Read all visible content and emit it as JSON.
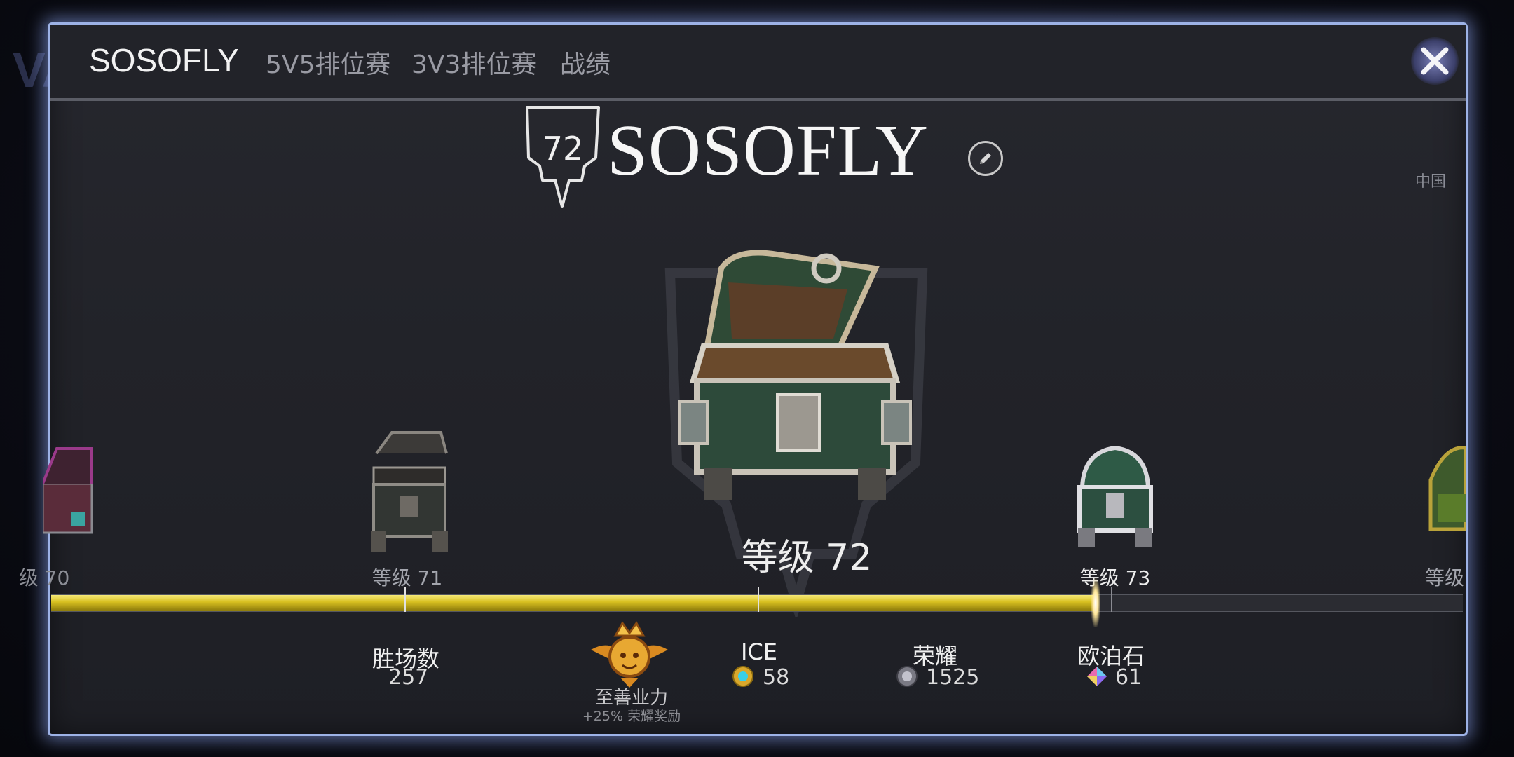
{
  "nav": {
    "title": "SOSOFLY",
    "tabs": [
      "5V5排位赛",
      "3V3排位赛",
      "战绩"
    ],
    "close_icon": "close-icon"
  },
  "region": "中国",
  "profile": {
    "rank_number": "72",
    "name": "SOSOFLY",
    "edit_icon": "pencil-icon"
  },
  "levels": {
    "prev2_label": "级 70",
    "prev_label": "等级 71",
    "current_label": "等级 72",
    "next_label": "等级 73",
    "next2_label": "等级"
  },
  "progress": {
    "percent": 74
  },
  "stats": {
    "wins_label": "胜场数",
    "wins_value": "257",
    "karma_title": "至善业力",
    "karma_bonus": "+25% 荣耀奖励",
    "ice_label": "ICE",
    "ice_value": "58",
    "glory_label": "荣耀",
    "glory_value": "1525",
    "opal_label": "欧泊石",
    "opal_value": "61"
  },
  "colors": {
    "accent_gold": "#d8c020",
    "frame_glow": "#9db2e6",
    "panel_bg": "#222329"
  }
}
